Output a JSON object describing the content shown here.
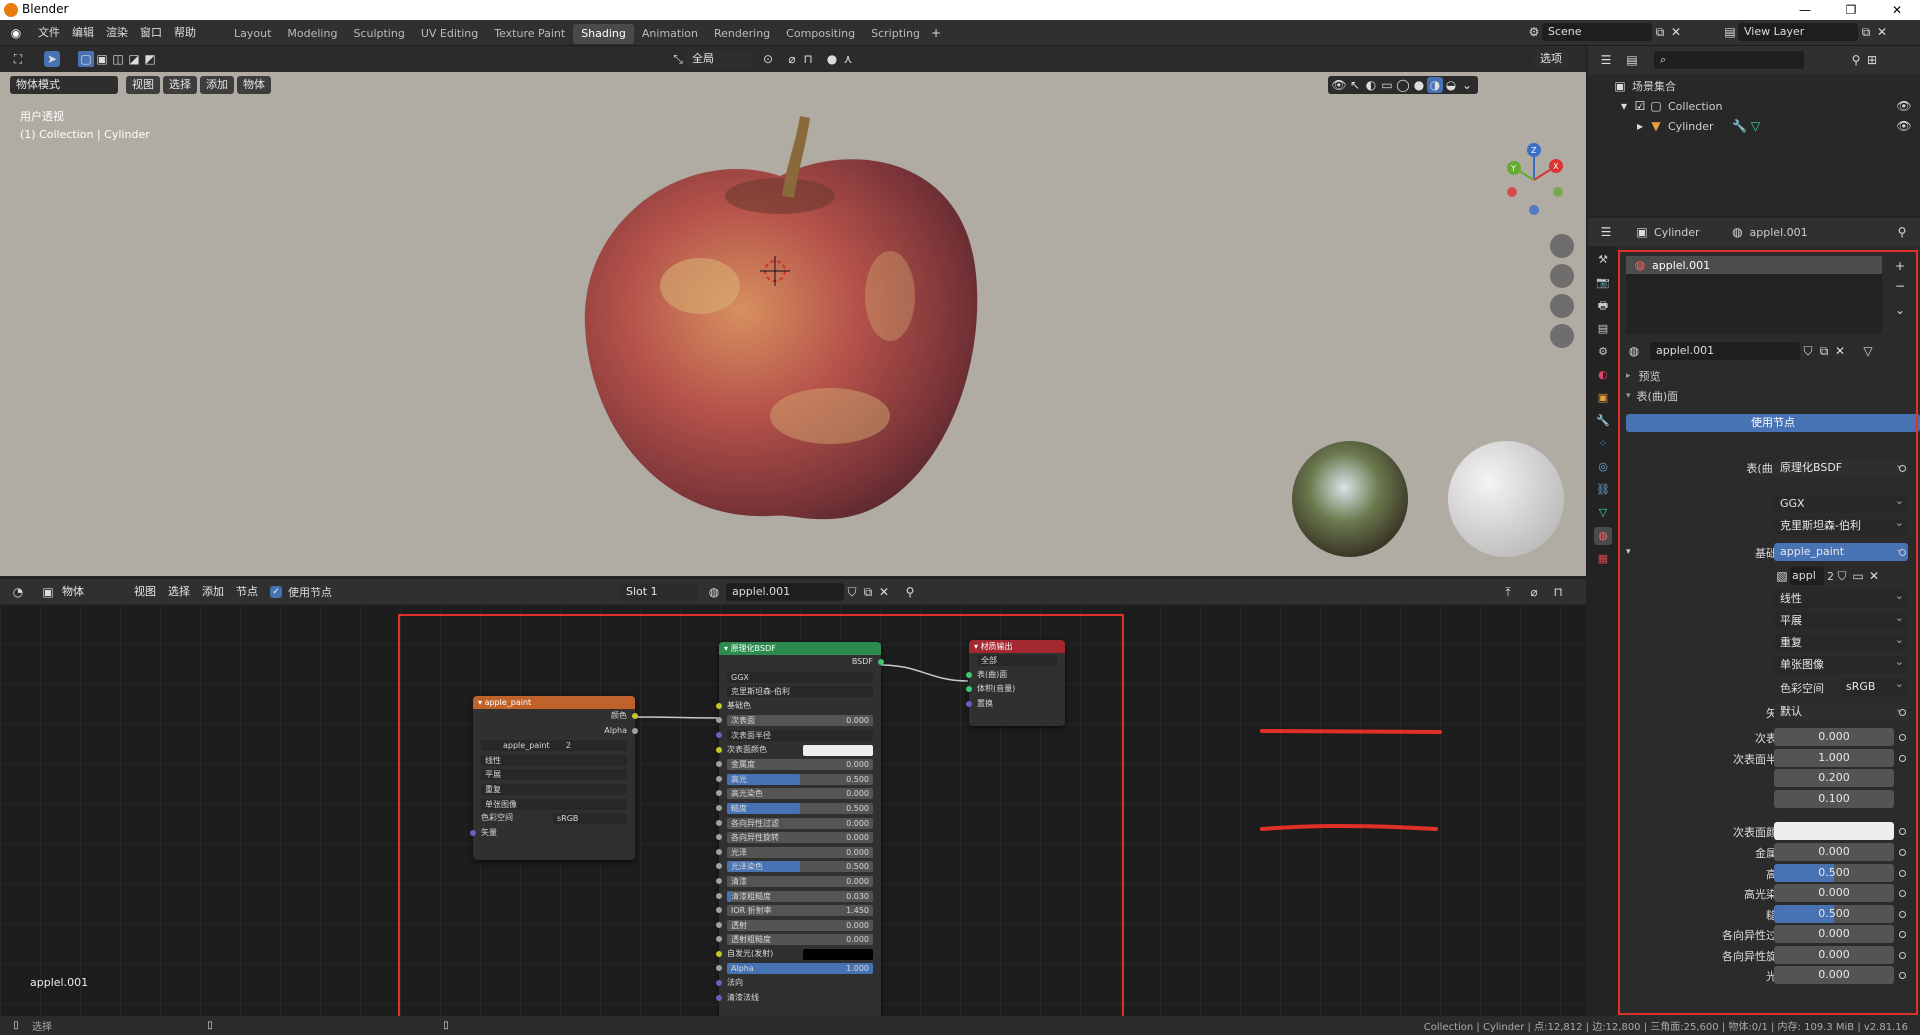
{
  "app": {
    "title": "Blender"
  },
  "window_controls": [
    "—",
    "❐",
    "✕"
  ],
  "menus": [
    "文件",
    "编辑",
    "渲染",
    "窗口",
    "帮助"
  ],
  "workspaces": [
    "Layout",
    "Modeling",
    "Sculpting",
    "UV Editing",
    "Texture Paint",
    "Shading",
    "Animation",
    "Rendering",
    "Compositing",
    "Scripting"
  ],
  "active_workspace": "Shading",
  "scene": {
    "name": "Scene",
    "view_layer": "View Layer"
  },
  "viewport": {
    "mode": "物体模式",
    "menus": [
      "视图",
      "选择",
      "添加",
      "物体"
    ],
    "transform_orient": "全局",
    "options": "选项",
    "overlay_text1": "用户透视",
    "overlay_text2": "(1) Collection | Cylinder",
    "gizmo": {
      "x": "X",
      "y": "Y",
      "z": "Z"
    }
  },
  "node_editor": {
    "type": "物体",
    "menus": [
      "视图",
      "选择",
      "添加",
      "节点"
    ],
    "use_nodes_label": "使用节点",
    "slot": "Slot 1",
    "material": "applel.001",
    "material_label": "applel.001",
    "image_node": {
      "title": "apple_paint",
      "out_color": "颜色",
      "out_alpha": "Alpha",
      "image": "apple_paint",
      "users": "2",
      "interp": "线性",
      "proj": "平展",
      "ext": "重复",
      "source": "单张图像",
      "cs_label": "色彩空间",
      "cs_value": "sRGB",
      "vector": "矢量"
    },
    "bsdf_node": {
      "title": "原理化BSDF",
      "out": "BSDF",
      "dist": "GGX",
      "sss_method": "克里斯坦森-伯利",
      "base_color": "基础色",
      "rows": [
        {
          "label": "次表面",
          "value": "0.000",
          "fill": 0
        },
        {
          "label": "次表面半径",
          "value": "",
          "fill": 0,
          "dropdown": true
        },
        {
          "label": "次表面颜色",
          "value": "",
          "fill": 0,
          "color": "#eeeeee"
        },
        {
          "label": "金属度",
          "value": "0.000",
          "fill": 0
        },
        {
          "label": "高光",
          "value": "0.500",
          "fill": 0.5
        },
        {
          "label": "高光染色",
          "value": "0.000",
          "fill": 0
        },
        {
          "label": "糙度",
          "value": "0.500",
          "fill": 0.5
        },
        {
          "label": "各向异性过滤",
          "value": "0.000",
          "fill": 0
        },
        {
          "label": "各向异性旋转",
          "value": "0.000",
          "fill": 0
        },
        {
          "label": "光泽",
          "value": "0.000",
          "fill": 0
        },
        {
          "label": "光泽染色",
          "value": "0.500",
          "fill": 0.5
        },
        {
          "label": "清漆",
          "value": "0.000",
          "fill": 0
        },
        {
          "label": "清漆粗糙度",
          "value": "0.030",
          "fill": 0.03
        },
        {
          "label": "IOR 折射率",
          "value": "1.450",
          "fill": 0
        },
        {
          "label": "透射",
          "value": "0.000",
          "fill": 0
        },
        {
          "label": "透射粗糙度",
          "value": "0.000",
          "fill": 0
        },
        {
          "label": "自发光(发射)",
          "value": "",
          "fill": 0,
          "color": "#000000"
        },
        {
          "label": "Alpha",
          "value": "1.000",
          "fill": 1
        },
        {
          "label": "法向",
          "value": "",
          "fill": 0,
          "socket_only": true
        },
        {
          "label": "清漆法线",
          "value": "",
          "fill": 0,
          "socket_only": true
        }
      ]
    },
    "output_node": {
      "title": "材质输出",
      "target": "全部",
      "inputs": [
        "表(曲)面",
        "体积(音量)",
        "置换"
      ]
    }
  },
  "outliner": {
    "root": "场景集合",
    "collection": "Collection",
    "object": "Cylinder"
  },
  "properties": {
    "object": "Cylinder",
    "material": "applel.001",
    "slot_item": "applel.001",
    "material_field": "applel.001",
    "preview": "预览",
    "surface_section": "表(曲)面",
    "use_nodes": "使用节点",
    "surface_label": "表(曲)面",
    "surface_value": "原理化BSDF",
    "dist": "GGX",
    "sss_method": "克里斯坦森-伯利",
    "base_color_label": "基础色",
    "base_color_value": "apple_paint",
    "image_name": "appl",
    "image_users": "2",
    "interp": "线性",
    "proj": "平展",
    "ext": "重复",
    "source": "单张图像",
    "cs_label": "色彩空间",
    "cs_value": "sRGB",
    "vector_label": "矢量",
    "vector_value": "默认",
    "fields": [
      {
        "label": "次表面",
        "value": "0.000",
        "fill": 0
      },
      {
        "label": "次表面半径",
        "value": "1.000",
        "fill": 0
      },
      {
        "label": "",
        "value": "0.200",
        "fill": 0
      },
      {
        "label": "",
        "value": "0.100",
        "fill": 0
      },
      {
        "label": "次表面颜色",
        "value": "",
        "fill": 0,
        "color": "#eeeeee"
      },
      {
        "label": "金属度",
        "value": "0.000",
        "fill": 0
      },
      {
        "label": "高光",
        "value": "0.500",
        "fill": 0.5
      },
      {
        "label": "高光染色",
        "value": "0.000",
        "fill": 0
      },
      {
        "label": "糙度",
        "value": "0.500",
        "fill": 0.5
      },
      {
        "label": "各向异性过滤",
        "value": "0.000",
        "fill": 0
      },
      {
        "label": "各向异性旋转",
        "value": "0.000",
        "fill": 0
      },
      {
        "label": "光泽",
        "value": "0.000",
        "fill": 0
      }
    ]
  },
  "status": {
    "left": "选择",
    "right": "Collection | Cylinder | 点:12,812 | 边:12,800 | 三角面:25,600 | 物体:0/1 | 内存: 109.3 MiB | v2.81.16"
  },
  "colors": {
    "accent": "#4772b3",
    "highlight_box": "#e0302a",
    "image_node_header": "#c0622b",
    "bsdf_header": "#2c8a4f",
    "output_header": "#a3282f"
  }
}
